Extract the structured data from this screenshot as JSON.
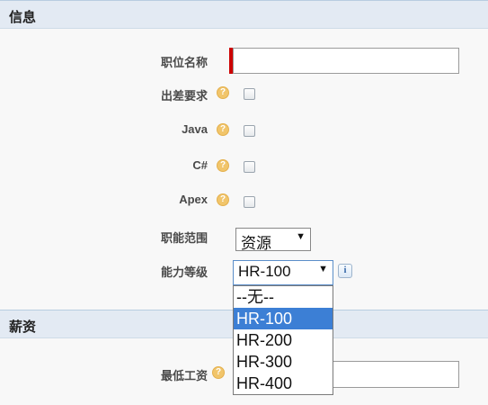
{
  "sections": {
    "info_title": "信息",
    "salary_title": "薪资"
  },
  "fields": {
    "position_name_label": "职位名称",
    "position_name_value": "",
    "travel_label": "出差要求",
    "java_label": "Java",
    "csharp_label": "C#",
    "apex_label": "Apex",
    "function_label": "职能范围",
    "function_value": "资源",
    "level_label": "能力等级",
    "level_value": "HR-100",
    "min_salary_label": "最低工资",
    "min_salary_value": ""
  },
  "level_options": [
    "--无--",
    "HR-100",
    "HR-200",
    "HR-300",
    "HR-400"
  ],
  "level_selected_index": 1,
  "icons": {
    "help": "help-icon",
    "info": "info-icon",
    "dropdown_arrow": "▼"
  },
  "colors": {
    "required": "#cc0000",
    "section_header": "#e3eaf3",
    "selected_option": "#3c7fd5"
  }
}
